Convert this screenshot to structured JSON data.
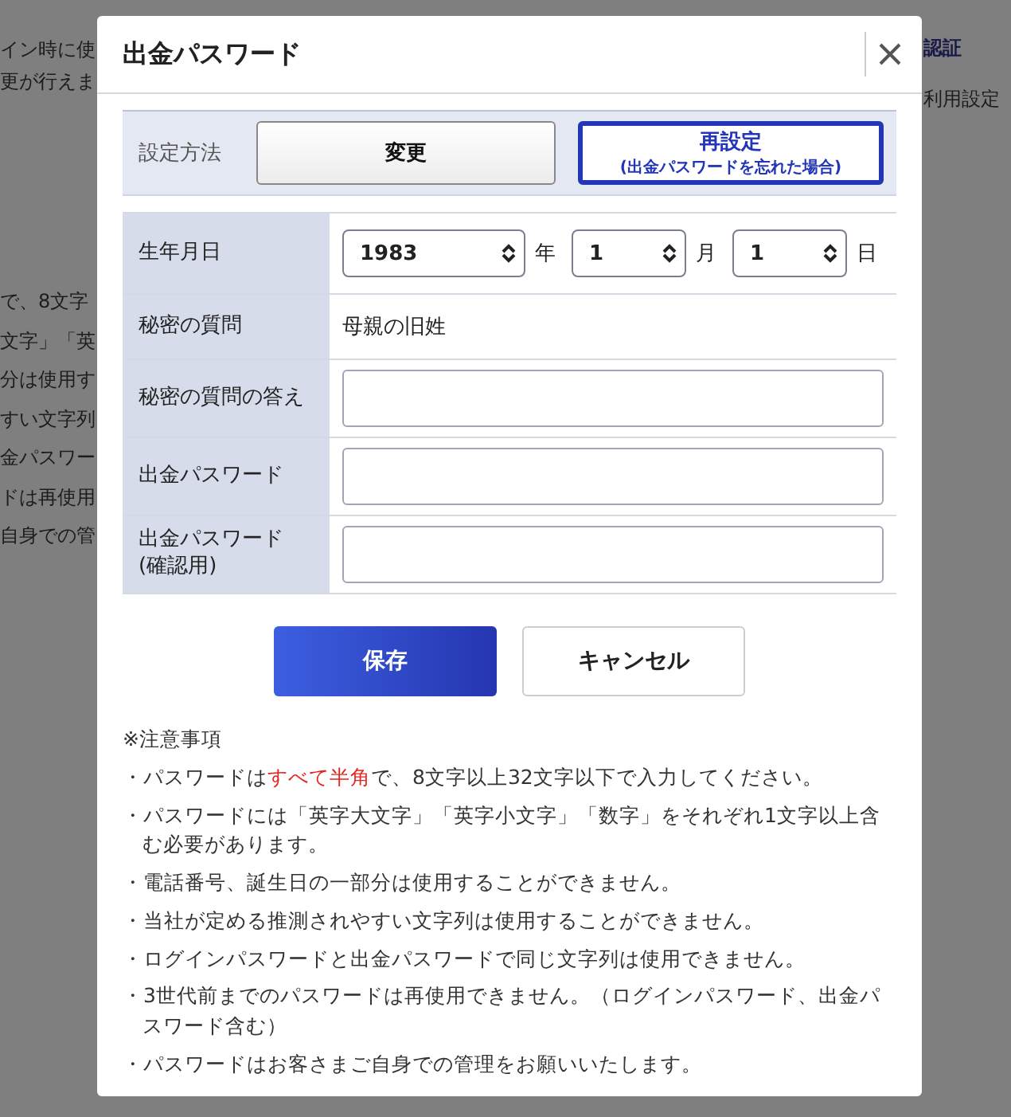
{
  "background": {
    "left_fragments": [
      {
        "text": "イン時に使",
        "emphasis": false
      },
      {
        "text": "更が行えま",
        "emphasis": false
      },
      {
        "text": "で、8文字",
        "emphasis": false
      },
      {
        "text": "文字」「英",
        "emphasis": false
      },
      {
        "text": "分は使用す",
        "emphasis": false
      },
      {
        "text": "すい文字列",
        "emphasis": false
      },
      {
        "text": "金パスワー",
        "emphasis": false
      },
      {
        "text": "ドは再使用",
        "emphasis": false
      },
      {
        "text": "自身での管",
        "emphasis": false
      }
    ],
    "right_fragments": [
      {
        "text": "認証",
        "emphasis": true
      },
      {
        "text": "利用設定",
        "emphasis": false
      }
    ]
  },
  "modal": {
    "title": "出金パスワード",
    "method": {
      "label": "設定方法",
      "options": [
        {
          "label": "変更",
          "selected": false
        },
        {
          "label": "再設定",
          "note": "(出金パスワードを忘れた場合)",
          "selected": true
        }
      ]
    },
    "form": {
      "rows": [
        {
          "kind": "date",
          "label": "生年月日",
          "parts": [
            {
              "value": "1983",
              "unit": "年"
            },
            {
              "value": "1",
              "unit": "月"
            },
            {
              "value": "1",
              "unit": "日"
            }
          ]
        },
        {
          "kind": "text",
          "label": "秘密の質問",
          "value": "母親の旧姓"
        },
        {
          "kind": "input",
          "label": "秘密の質問の答え"
        },
        {
          "kind": "input",
          "label": "出金パスワード"
        },
        {
          "kind": "input",
          "label": "出金パスワード\n(確認用)"
        }
      ]
    },
    "actions": [
      {
        "label": "保存",
        "kind": "primary"
      },
      {
        "label": "キャンセル",
        "kind": "secondary"
      }
    ],
    "notes": {
      "heading": "※注意事項",
      "items": [
        {
          "parts": [
            {
              "text": "・パスワードは",
              "highlight": false
            },
            {
              "text": "すべて半角",
              "highlight": true
            },
            {
              "text": "で、8文字以上32文字以下で入力してください。",
              "highlight": false
            }
          ]
        },
        {
          "parts": [
            {
              "text": "・パスワードには「英字大文字」「英字小文字」「数字」をそれぞれ1文字以上含む必要があります。",
              "highlight": false
            }
          ]
        },
        {
          "parts": [
            {
              "text": "・電話番号、誕生日の一部分は使用することができません。",
              "highlight": false
            }
          ]
        },
        {
          "parts": [
            {
              "text": "・当社が定める推測されやすい文字列は使用することができません。",
              "highlight": false
            }
          ]
        },
        {
          "parts": [
            {
              "text": "・ログインパスワードと出金パスワードで同じ文字列は使用できません。",
              "highlight": false
            }
          ]
        },
        {
          "parts": [
            {
              "text": "・3世代前までのパスワードは再使用できません。（ログインパスワード、出金パスワード含む）",
              "highlight": false
            }
          ]
        },
        {
          "parts": [
            {
              "text": "・パスワードはお客さまご自身での管理をお願いいたします。",
              "highlight": false
            }
          ]
        }
      ]
    }
  }
}
